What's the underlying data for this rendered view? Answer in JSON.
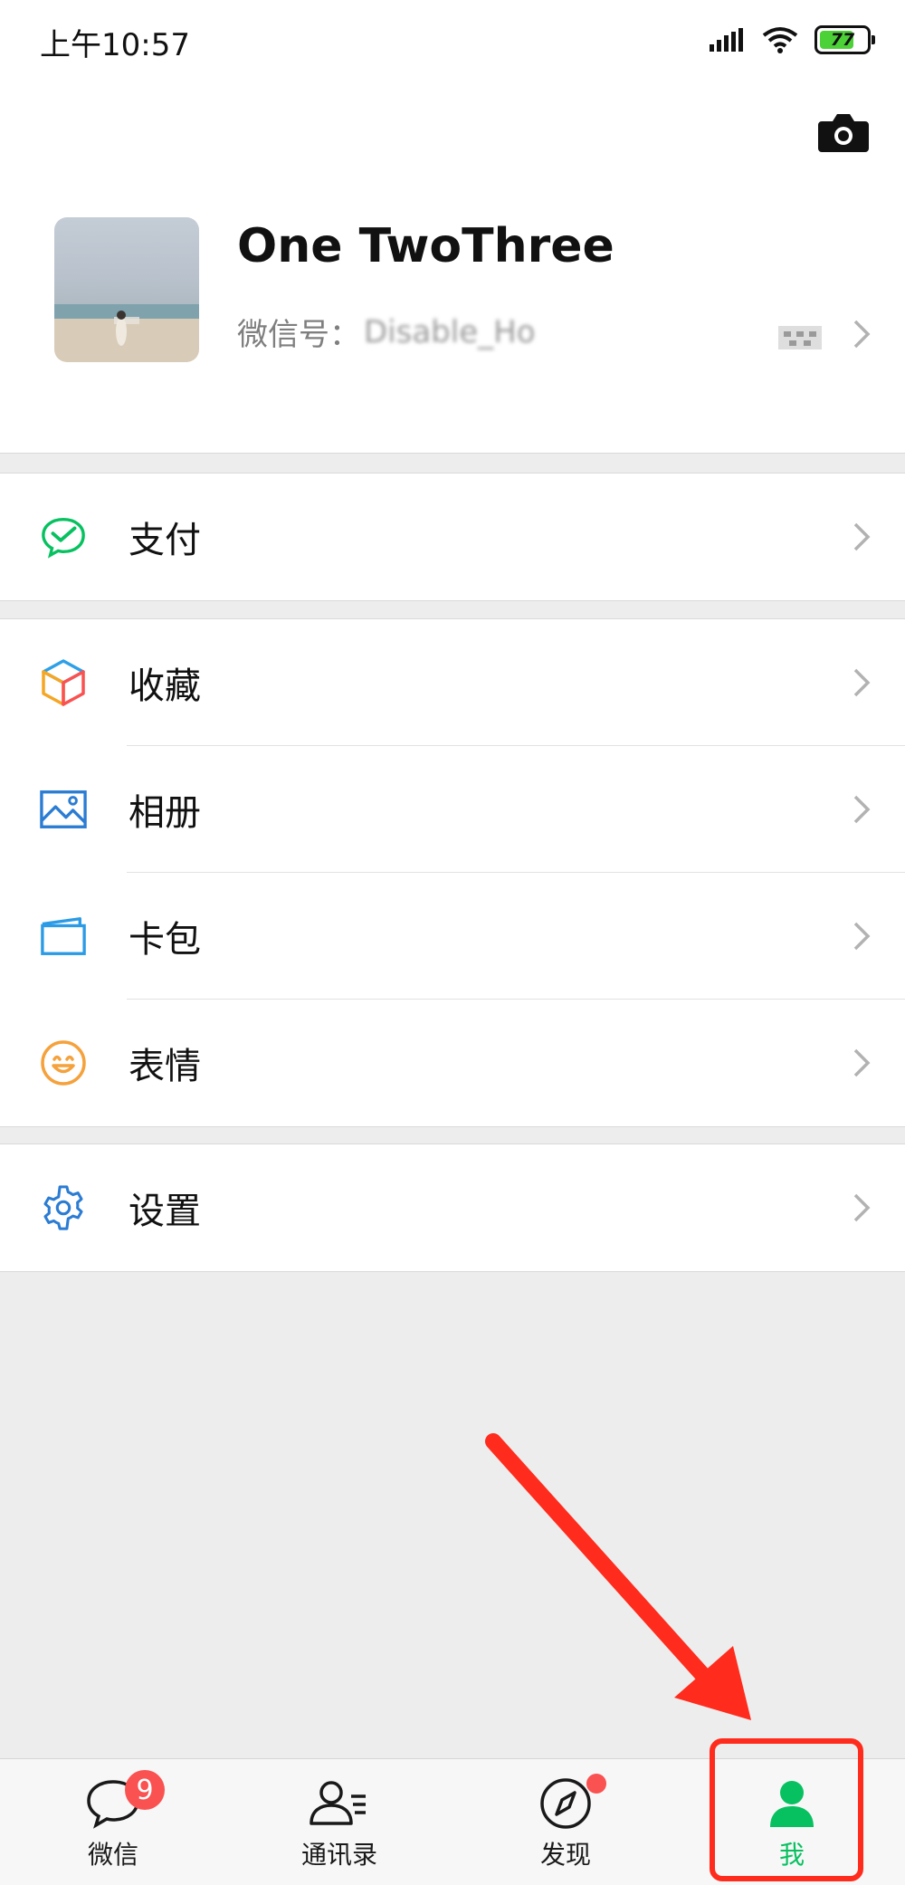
{
  "status_bar": {
    "time": "上午10:57",
    "battery": "77",
    "battery_level": 0.77,
    "icons": [
      "signal-icon",
      "wifi-icon",
      "battery-icon"
    ]
  },
  "profile": {
    "name": "One TwoThree",
    "wechat_id_label": "微信号：",
    "wechat_id_value": "Disable_Ho"
  },
  "menu": {
    "pay": {
      "label": "支付",
      "icon": "wechat-pay-icon",
      "color": "#07c160"
    },
    "favorites": {
      "label": "收藏",
      "icon": "favorites-cube-icon"
    },
    "album": {
      "label": "相册",
      "icon": "album-icon",
      "color": "#2b7cd3"
    },
    "cards": {
      "label": "卡包",
      "icon": "card-wallet-icon",
      "color": "#2b9be6"
    },
    "stickers": {
      "label": "表情",
      "icon": "sticker-smile-icon",
      "color": "#f5a13c"
    },
    "settings": {
      "label": "设置",
      "icon": "settings-gear-icon",
      "color": "#2b7cd3"
    }
  },
  "tabbar": {
    "tabs": [
      {
        "label": "微信",
        "icon": "chat-bubble-icon",
        "badge": "9"
      },
      {
        "label": "通讯录",
        "icon": "contacts-icon"
      },
      {
        "label": "发现",
        "icon": "discover-compass-icon",
        "dot": true
      },
      {
        "label": "我",
        "icon": "me-person-icon",
        "active": true
      }
    ]
  },
  "colors": {
    "accent": "#07c160",
    "badge": "#fa5151",
    "annotation": "#ff2b1c"
  }
}
